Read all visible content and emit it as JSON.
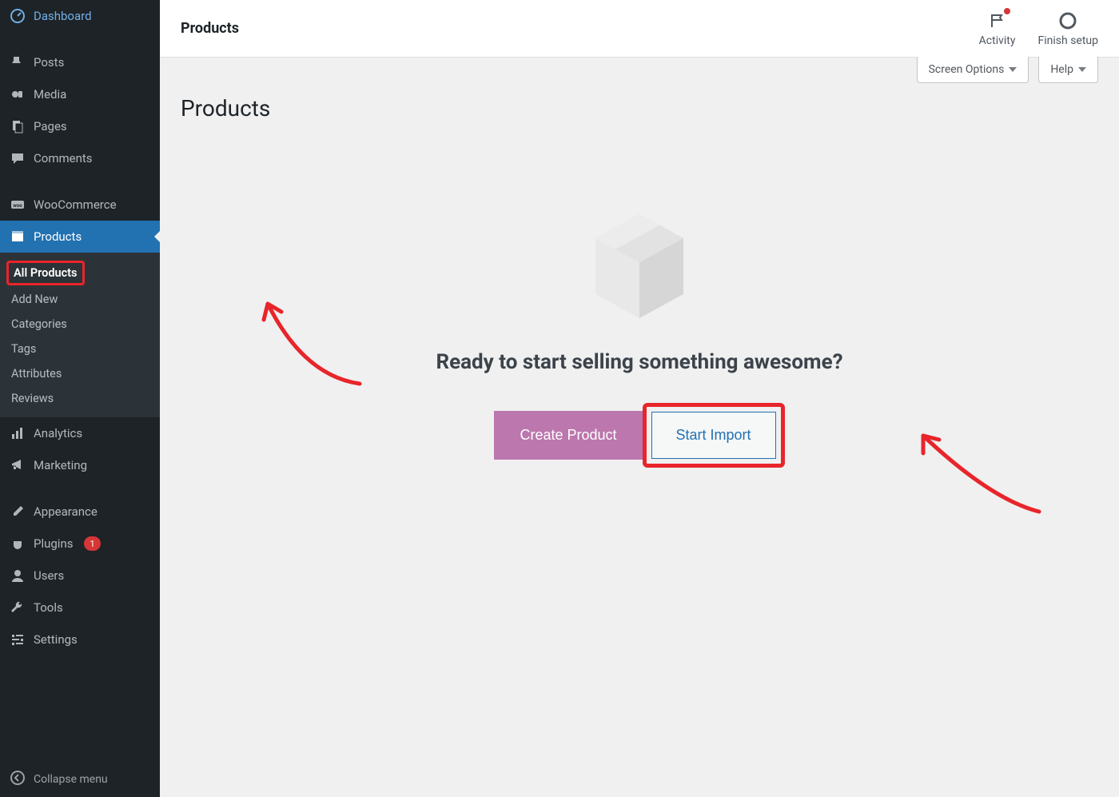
{
  "sidebar": {
    "items": [
      {
        "label": "Dashboard",
        "icon": "dashboard"
      },
      {
        "label": "Posts",
        "icon": "pin"
      },
      {
        "label": "Media",
        "icon": "media"
      },
      {
        "label": "Pages",
        "icon": "pages"
      },
      {
        "label": "Comments",
        "icon": "comments"
      },
      {
        "label": "WooCommerce",
        "icon": "woo"
      },
      {
        "label": "Products",
        "icon": "products",
        "active": true
      },
      {
        "label": "Analytics",
        "icon": "analytics"
      },
      {
        "label": "Marketing",
        "icon": "marketing"
      },
      {
        "label": "Appearance",
        "icon": "appearance"
      },
      {
        "label": "Plugins",
        "icon": "plugins",
        "badge": "1"
      },
      {
        "label": "Users",
        "icon": "users"
      },
      {
        "label": "Tools",
        "icon": "tools"
      },
      {
        "label": "Settings",
        "icon": "settings"
      }
    ],
    "submenu": [
      {
        "label": "All Products",
        "current": true
      },
      {
        "label": "Add New"
      },
      {
        "label": "Categories"
      },
      {
        "label": "Tags"
      },
      {
        "label": "Attributes"
      },
      {
        "label": "Reviews"
      }
    ],
    "collapse_label": "Collapse menu"
  },
  "topbar": {
    "title": "Products",
    "activity_label": "Activity",
    "finish_label": "Finish setup"
  },
  "options": {
    "screen_options": "Screen Options",
    "help": "Help"
  },
  "page": {
    "heading": "Products",
    "empty_heading": "Ready to start selling something awesome?",
    "create_btn": "Create Product",
    "import_btn": "Start Import"
  },
  "colors": {
    "annotation": "#e8252a",
    "primary_btn": "#bb77ae",
    "link": "#2271b1"
  }
}
